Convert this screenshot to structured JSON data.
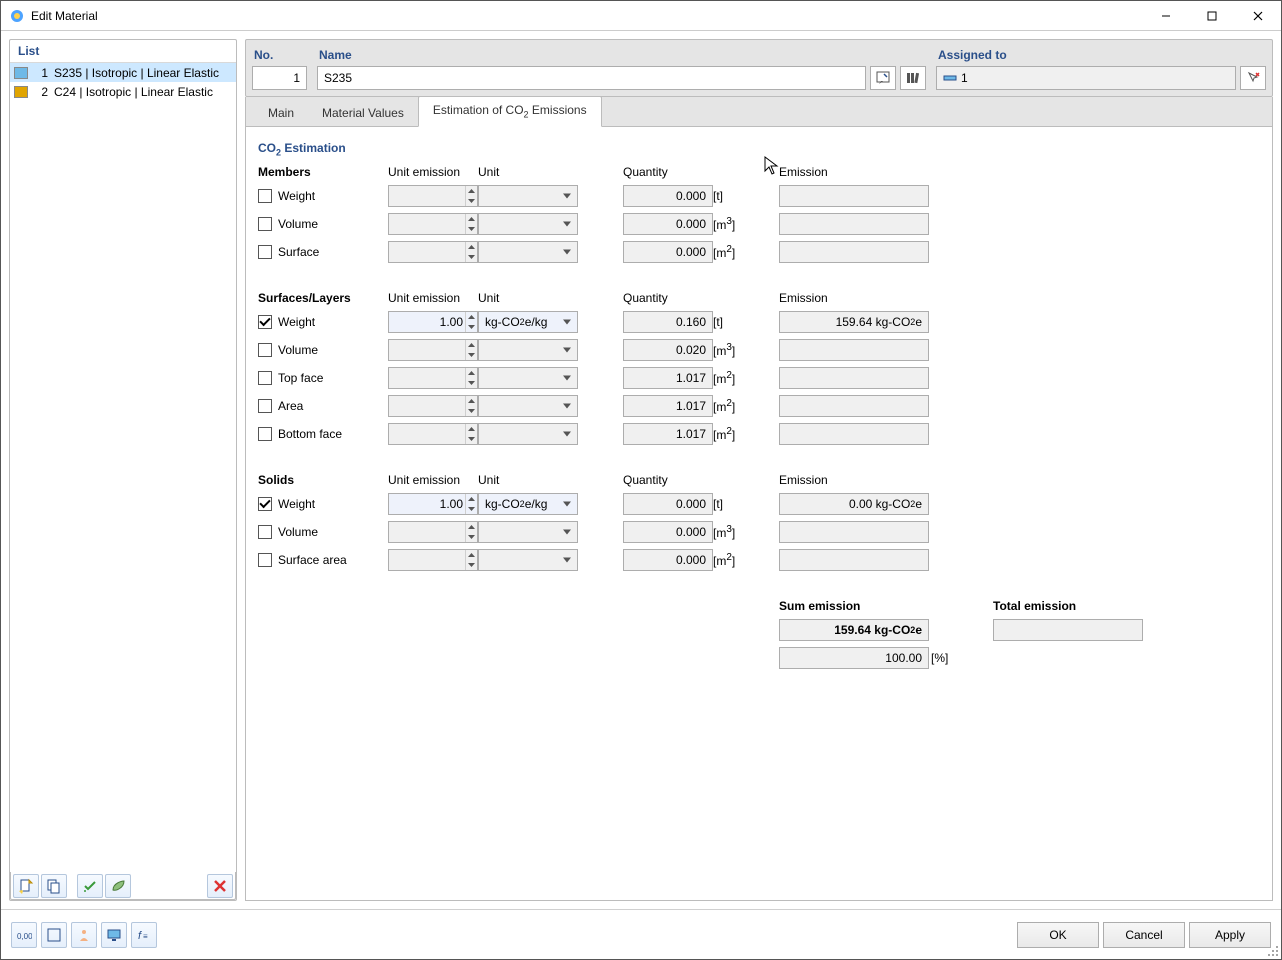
{
  "window": {
    "title": "Edit Material"
  },
  "list": {
    "header": "List",
    "items": [
      {
        "num": "1",
        "label": "S235 | Isotropic | Linear Elastic",
        "color": "#6eb9e7",
        "selected": true
      },
      {
        "num": "2",
        "label": "C24 | Isotropic | Linear Elastic",
        "color": "#e0a400",
        "selected": false
      }
    ]
  },
  "header_fields": {
    "no_label": "No.",
    "no_value": "1",
    "name_label": "Name",
    "name_value": "S235",
    "assigned_label": "Assigned to",
    "assigned_value": "1"
  },
  "tabs": {
    "main": "Main",
    "material_values": "Material Values",
    "est_prefix": "Estimation of CO",
    "est_sub": "2",
    "est_suffix": " Emissions"
  },
  "section_title_prefix": "CO",
  "section_title_sub": "2",
  "section_title_suffix": " Estimation",
  "headers": {
    "unit_emission": "Unit emission",
    "unit": "Unit",
    "quantity": "Quantity",
    "emission": "Emission"
  },
  "groups": {
    "members": "Members",
    "surfaces_layers": "Surfaces/Layers",
    "solids": "Solids"
  },
  "rows": {
    "members_weight": {
      "label": "Weight",
      "checked": false,
      "ue": "",
      "unit": "",
      "q": "0.000",
      "qu": "[t]",
      "em": ""
    },
    "members_volume": {
      "label": "Volume",
      "checked": false,
      "ue": "",
      "unit": "",
      "q": "0.000",
      "qu_pre": "[m",
      "qu_sup": "3",
      "qu_suf": "]",
      "em": ""
    },
    "members_surface": {
      "label": "Surface",
      "checked": false,
      "ue": "",
      "unit": "",
      "q": "0.000",
      "qu_pre": "[m",
      "qu_sup": "2",
      "qu_suf": "]",
      "em": ""
    },
    "sl_weight": {
      "label": "Weight",
      "checked": true,
      "ue": "1.00",
      "unit_pre": "kg-CO",
      "unit_sub": "2",
      "unit_suf": "e/kg",
      "q": "0.160",
      "qu": "[t]",
      "em_val": "159.64 kg-CO",
      "em_sub": "2",
      "em_suf": "e"
    },
    "sl_volume": {
      "label": "Volume",
      "checked": false,
      "ue": "",
      "unit": "",
      "q": "0.020",
      "qu_pre": "[m",
      "qu_sup": "3",
      "qu_suf": "]",
      "em": ""
    },
    "sl_topface": {
      "label": "Top face",
      "checked": false,
      "ue": "",
      "unit": "",
      "q": "1.017",
      "qu_pre": "[m",
      "qu_sup": "2",
      "qu_suf": "]",
      "em": ""
    },
    "sl_area": {
      "label": "Area",
      "checked": false,
      "ue": "",
      "unit": "",
      "q": "1.017",
      "qu_pre": "[m",
      "qu_sup": "2",
      "qu_suf": "]",
      "em": ""
    },
    "sl_bottomface": {
      "label": "Bottom face",
      "checked": false,
      "ue": "",
      "unit": "",
      "q": "1.017",
      "qu_pre": "[m",
      "qu_sup": "2",
      "qu_suf": "]",
      "em": ""
    },
    "so_weight": {
      "label": "Weight",
      "checked": true,
      "ue": "1.00",
      "unit_pre": "kg-CO",
      "unit_sub": "2",
      "unit_suf": "e/kg",
      "q": "0.000",
      "qu": "[t]",
      "em_val": "0.00 kg-CO",
      "em_sub": "2",
      "em_suf": "e"
    },
    "so_volume": {
      "label": "Volume",
      "checked": false,
      "ue": "",
      "unit": "",
      "q": "0.000",
      "qu_pre": "[m",
      "qu_sup": "3",
      "qu_suf": "]",
      "em": ""
    },
    "so_surfacearea": {
      "label": "Surface area",
      "checked": false,
      "ue": "",
      "unit": "",
      "q": "0.000",
      "qu_pre": "[m",
      "qu_sup": "2",
      "qu_suf": "]",
      "em": ""
    }
  },
  "sum": {
    "sum_label": "Sum emission",
    "total_label": "Total emission",
    "sum_val": "159.64 kg-CO",
    "sum_sub": "2",
    "sum_suf": "e",
    "pct": "100.00",
    "pct_unit": "[%]"
  },
  "buttons": {
    "ok": "OK",
    "cancel": "Cancel",
    "apply": "Apply"
  }
}
